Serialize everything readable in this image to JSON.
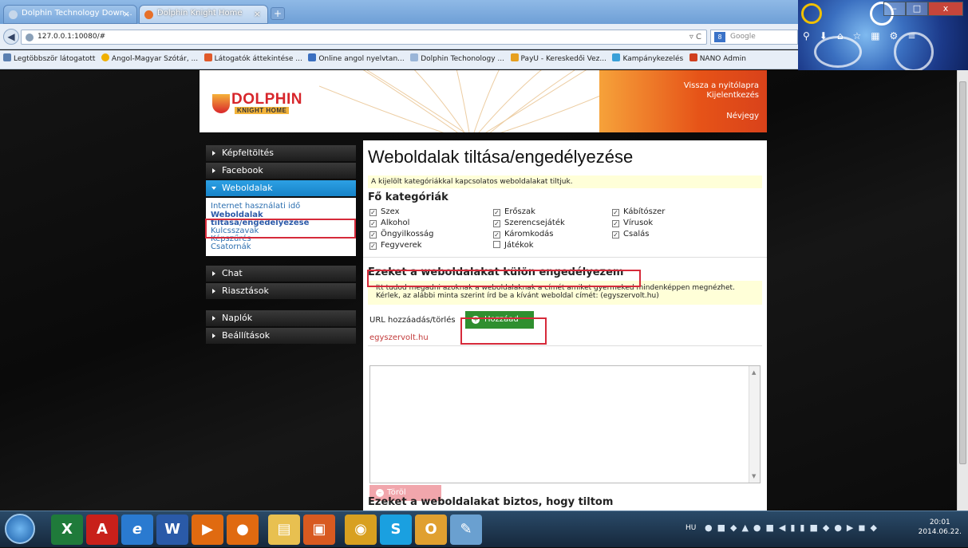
{
  "browser": {
    "tabs": [
      {
        "title": "Dolphin Technology Down...",
        "close": "×"
      },
      {
        "title": "Dolphin Knight Home",
        "close": "×"
      }
    ],
    "new_tab": "+",
    "url": "127.0.0.1:10080/#",
    "search_placeholder": "Google",
    "window_buttons": {
      "minimize": "–",
      "maximize": "□",
      "close": "x"
    },
    "bookmarks": [
      {
        "label": "Legtöbbször látogatott",
        "color": "#5a7fb0"
      },
      {
        "label": "Angol-Magyar Szótár, ...",
        "color": "#f0b000"
      },
      {
        "label": "Látogatók áttekintése ...",
        "color": "#e05a2a"
      },
      {
        "label": "Online angol nyelvtan...",
        "color": "#3b6fc0"
      },
      {
        "label": "Dolphin Techonology ...",
        "color": "#9ab5d8"
      },
      {
        "label": "PayU - Kereskedői Vez...",
        "color": "#e6a020"
      },
      {
        "label": "Kampánykezelés",
        "color": "#3aa0d8"
      },
      {
        "label": "NANO Admin",
        "color": "#d04020"
      }
    ]
  },
  "header": {
    "logo_name": "DOLPHIN",
    "logo_sub": "KNIGHT HOME",
    "links": [
      "Vissza a nyitólapra",
      "Kijelentkezés",
      "Névjegy"
    ]
  },
  "sidebar": {
    "sections": [
      {
        "label": "Képfeltöltés",
        "active": false
      },
      {
        "label": "Facebook",
        "active": false
      },
      {
        "label": "Weboldalak",
        "active": true
      },
      {
        "label": "Chat",
        "active": false
      },
      {
        "label": "Riasztások",
        "active": false
      },
      {
        "label": "Naplók",
        "active": false
      },
      {
        "label": "Beállítások",
        "active": false
      }
    ],
    "submenu": [
      "Internet használati idő",
      "Weboldalak tiltása/engedélyezése",
      "Kulcsszavak",
      "Képszűrés",
      "Csatornák"
    ]
  },
  "main": {
    "title": "Weboldalak tiltása/engedélyezése",
    "notice": "A kijelölt kategóriákkal kapcsolatos weboldalakat tiltjuk.",
    "categories_label": "Fő kategóriák",
    "categories": [
      {
        "label": "Szex",
        "checked": true
      },
      {
        "label": "Alkohol",
        "checked": true
      },
      {
        "label": "Öngyilkosság",
        "checked": true
      },
      {
        "label": "Fegyverek",
        "checked": true
      },
      {
        "label": "Erőszak",
        "checked": true
      },
      {
        "label": "Szerencsejáték",
        "checked": true
      },
      {
        "label": "Káromkodás",
        "checked": true
      },
      {
        "label": "Játékok",
        "checked": false
      },
      {
        "label": "Kábítószer",
        "checked": true
      },
      {
        "label": "Vírusok",
        "checked": true
      },
      {
        "label": "Csalás",
        "checked": true
      }
    ],
    "allow_section_title": "Ezeket a weboldalakat külön engedélyezem",
    "allow_notice": "Itt tudod megadni azoknak a weboldalaknak a címét amiket gyermeked mindenképpen megnézhet. Kérlek, az alábbi minta szerint írd be a kívánt weboldal címét: (egyszervolt.hu)",
    "url_label": "URL hozzáadás/törlés",
    "add_button": "Hozzáad",
    "url_input_value": "egyszervolt.hu",
    "delete_button": "Töröl",
    "block_section_title": "Ezeket a weboldalakat biztos, hogy tiltom"
  },
  "taskbar": {
    "apps": [
      {
        "name": "excel",
        "glyph": "X",
        "color": "#1f7a3a"
      },
      {
        "name": "acrobat",
        "glyph": "A",
        "color": "#c8201a"
      },
      {
        "name": "internet-explorer",
        "glyph": "e",
        "color": "#2a7ad0"
      },
      {
        "name": "word",
        "glyph": "W",
        "color": "#2a5aa8"
      },
      {
        "name": "media-player",
        "glyph": "▶",
        "color": "#e06a10"
      },
      {
        "name": "firefox",
        "glyph": "●",
        "color": "#e06a10"
      },
      {
        "name": "explorer",
        "glyph": "▤",
        "color": "#e8c050"
      },
      {
        "name": "app-orange",
        "glyph": "▣",
        "color": "#d85a20"
      },
      {
        "name": "chrome",
        "glyph": "◉",
        "color": "#d8a020"
      },
      {
        "name": "skype",
        "glyph": "S",
        "color": "#1aa0e0"
      },
      {
        "name": "app-os",
        "glyph": "O",
        "color": "#e0a030"
      },
      {
        "name": "paint",
        "glyph": "✎",
        "color": "#6aa0d0"
      }
    ],
    "lang": "HU",
    "time": "20:01",
    "date": "2014.06.22."
  }
}
